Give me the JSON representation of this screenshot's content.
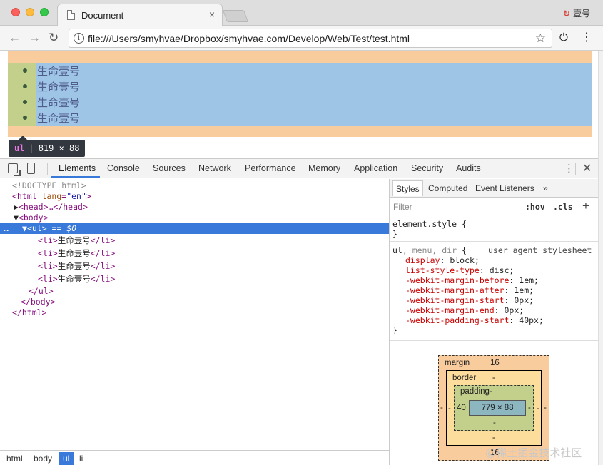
{
  "tab": {
    "title": "Document",
    "close": "×"
  },
  "profile": {
    "label": "壹号",
    "icon": "sync-icon"
  },
  "toolbar": {
    "back": "←",
    "forward": "→",
    "reload": "C",
    "info": "i",
    "url": "file:///Users/smyhvae/Dropbox/smyhvae.com/Develop/Web/Test/test.html",
    "star": "☆",
    "power": "⏻",
    "menu": "⋮"
  },
  "page": {
    "list_items": [
      "生命壹号",
      "生命壹号",
      "生命壹号",
      "生命壹号"
    ],
    "tooltip": {
      "tag": "ul",
      "size": "819 × 88"
    }
  },
  "devtools": {
    "tabs": [
      "Elements",
      "Console",
      "Sources",
      "Network",
      "Performance",
      "Memory",
      "Application",
      "Security",
      "Audits"
    ],
    "menu": "⋮",
    "close": "✕",
    "tree": {
      "doctype": "<!DOCTYPE html>",
      "html_open": "<html",
      "html_lang_attr": "lang",
      "html_lang_val": "\"en\"",
      "gt": ">",
      "head": "<head>…</head>",
      "body_open": "<body>",
      "ul_open": "<ul>",
      "ul_eq": " == $0",
      "li_open": "<li>",
      "li_text": "生命壹号",
      "li_close": "</li>",
      "ul_close": "</ul>",
      "body_close": "</body>",
      "html_close": "</html>",
      "sel_dots": "…"
    },
    "breadcrumbs": [
      "html",
      "body",
      "ul",
      "li"
    ],
    "styles_tabs": [
      "Styles",
      "Computed",
      "Event Listeners",
      "»"
    ],
    "filter_placeholder": "Filter",
    "hov": ":hov",
    "cls": ".cls",
    "plus": "+",
    "element_style": {
      "selector": "element.style",
      "open": " {",
      "close": "}"
    },
    "ua_rule": {
      "selector_main": "ul",
      "selector_rest": ", menu, dir",
      "open": " {",
      "source": "user agent stylesheet",
      "declarations": [
        {
          "prop": "display",
          "val": "block;"
        },
        {
          "prop": "list-style-type",
          "val": "disc;"
        },
        {
          "prop": "-webkit-margin-before",
          "val": "1em;"
        },
        {
          "prop": "-webkit-margin-after",
          "val": "1em;"
        },
        {
          "prop": "-webkit-margin-start",
          "val": "0px;"
        },
        {
          "prop": "-webkit-margin-end",
          "val": "0px;"
        },
        {
          "prop": "-webkit-padding-start",
          "val": "40px;"
        }
      ],
      "close": "}"
    },
    "box_model": {
      "margin_label": "margin",
      "margin_top": "16",
      "margin_bottom": "16",
      "margin_left": "-",
      "margin_right": "-",
      "border_label": "border",
      "border_top": "-",
      "border_bottom": "-",
      "border_left": "-",
      "border_right": "-",
      "padding_label": "padding-",
      "padding_left": "40",
      "padding_right": "-",
      "padding_bottom": "-",
      "content": "779 × 88"
    }
  },
  "watermark": "@稀土掘金技术社区"
}
